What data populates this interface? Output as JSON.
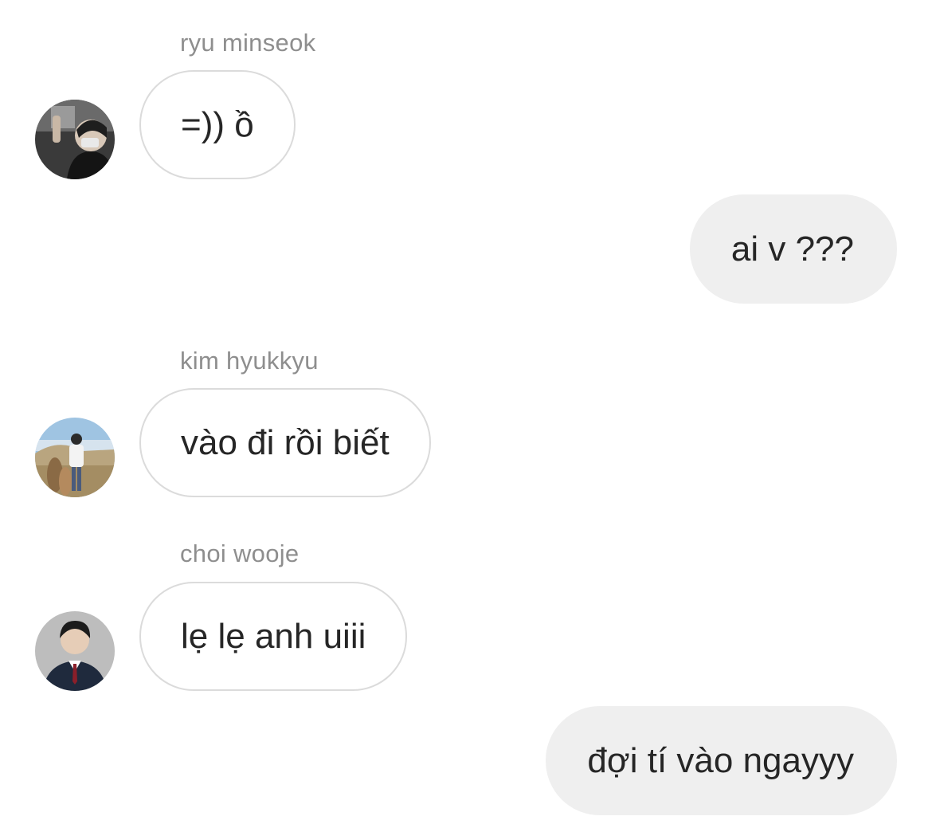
{
  "messages": [
    {
      "sender": "ryu minseok",
      "direction": "incoming",
      "text": "=)) ồ",
      "avatar": "avatar-ryu-minseok"
    },
    {
      "direction": "outgoing",
      "text": "ai v ???"
    },
    {
      "sender": "kim hyukkyu",
      "direction": "incoming",
      "text": "vào đi rồi biết",
      "avatar": "avatar-kim-hyukkyu"
    },
    {
      "sender": "choi wooje",
      "direction": "incoming",
      "text": "lẹ lẹ anh uiii",
      "avatar": "avatar-choi-wooje"
    },
    {
      "direction": "outgoing",
      "text": "đợi tí vào ngayyy"
    }
  ],
  "colors": {
    "background": "#ffffff",
    "incoming_bubble_border": "#dbdbdb",
    "outgoing_bubble": "#efefef",
    "sender_name": "#8e8e8e",
    "message_text": "#262626"
  }
}
